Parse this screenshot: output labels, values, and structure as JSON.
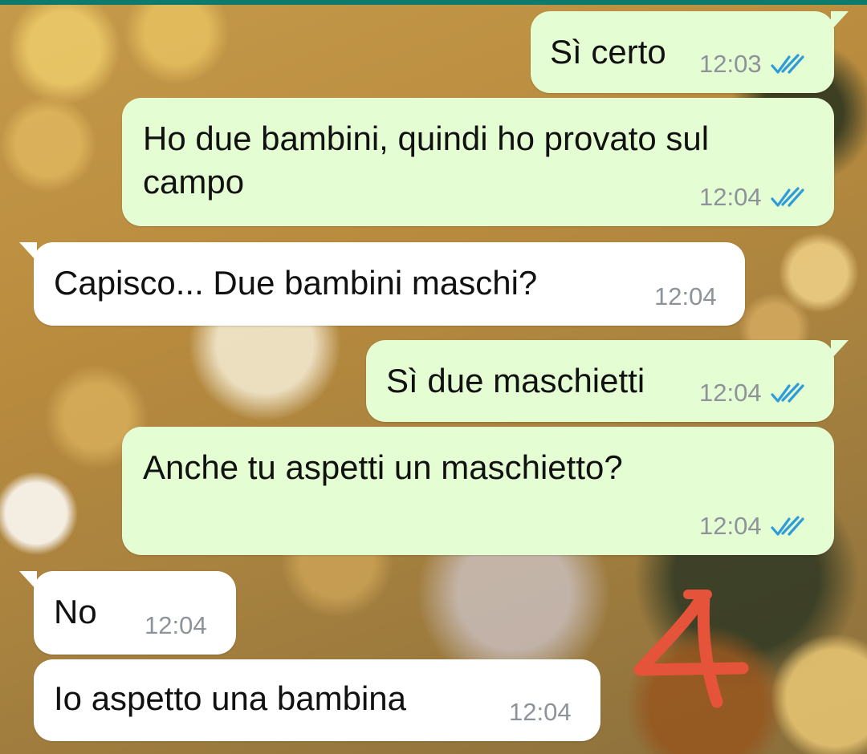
{
  "chat": {
    "messages": [
      {
        "direction": "outgoing",
        "text": "Sì certo",
        "time": "12:03",
        "status": "read"
      },
      {
        "direction": "outgoing",
        "text": "Ho due bambini, quindi ho provato sul\ncampo",
        "time": "12:04",
        "status": "read"
      },
      {
        "direction": "incoming",
        "text": "Capisco... Due bambini maschi?",
        "time": "12:04"
      },
      {
        "direction": "outgoing",
        "text": "Sì due maschietti",
        "time": "12:04",
        "status": "read"
      },
      {
        "direction": "outgoing",
        "text": "Anche tu aspetti un maschietto?",
        "time": "12:04",
        "status": "read"
      },
      {
        "direction": "incoming",
        "text": "No",
        "time": "12:04"
      },
      {
        "direction": "incoming",
        "text": "Io aspetto una bambina",
        "time": "12:04"
      }
    ]
  },
  "annotation": {
    "text": "4",
    "color": "#e4533a"
  },
  "colors": {
    "outgoing_bubble": "#e4fdd3",
    "incoming_bubble": "#ffffff",
    "read_ticks": "#2f9bd8",
    "timestamp": "#8d9399",
    "top_bar": "#0d7a6b"
  },
  "icons": {
    "read_receipt": "double-check-icon"
  }
}
